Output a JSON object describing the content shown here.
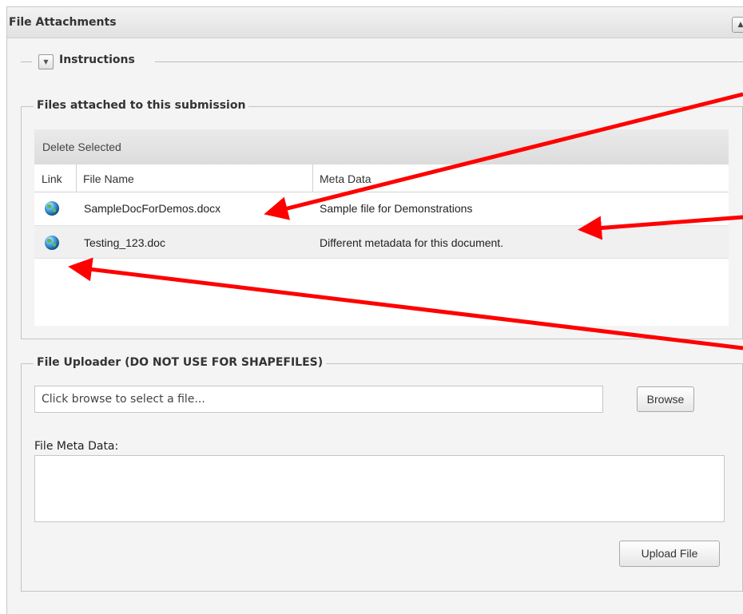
{
  "panel": {
    "title": "File Attachments",
    "collapse_icon": "triangle-up-icon"
  },
  "instructions": {
    "legend": "Instructions",
    "toggle_icon": "triangle-down-icon"
  },
  "attached": {
    "legend": "Files attached to this submission",
    "toolbar": {
      "delete_label": "Delete Selected"
    },
    "columns": {
      "link": "Link",
      "file_name": "File Name",
      "meta_data": "Meta Data"
    },
    "rows": [
      {
        "icon": "globe-download-icon",
        "file_name": "SampleDocForDemos.docx",
        "meta_data": "Sample file for Demonstrations"
      },
      {
        "icon": "globe-download-icon",
        "file_name": "Testing_123.doc",
        "meta_data": "Different metadata for this document."
      }
    ]
  },
  "uploader": {
    "legend": "File Uploader (DO NOT USE FOR SHAPEFILES)",
    "file_input_placeholder": "Click browse to select a file...",
    "browse_label": "Browse",
    "meta_label": "File Meta Data:",
    "meta_value": "",
    "upload_label": "Upload File"
  },
  "annotation": {
    "arrow_color": "#ff0000"
  }
}
